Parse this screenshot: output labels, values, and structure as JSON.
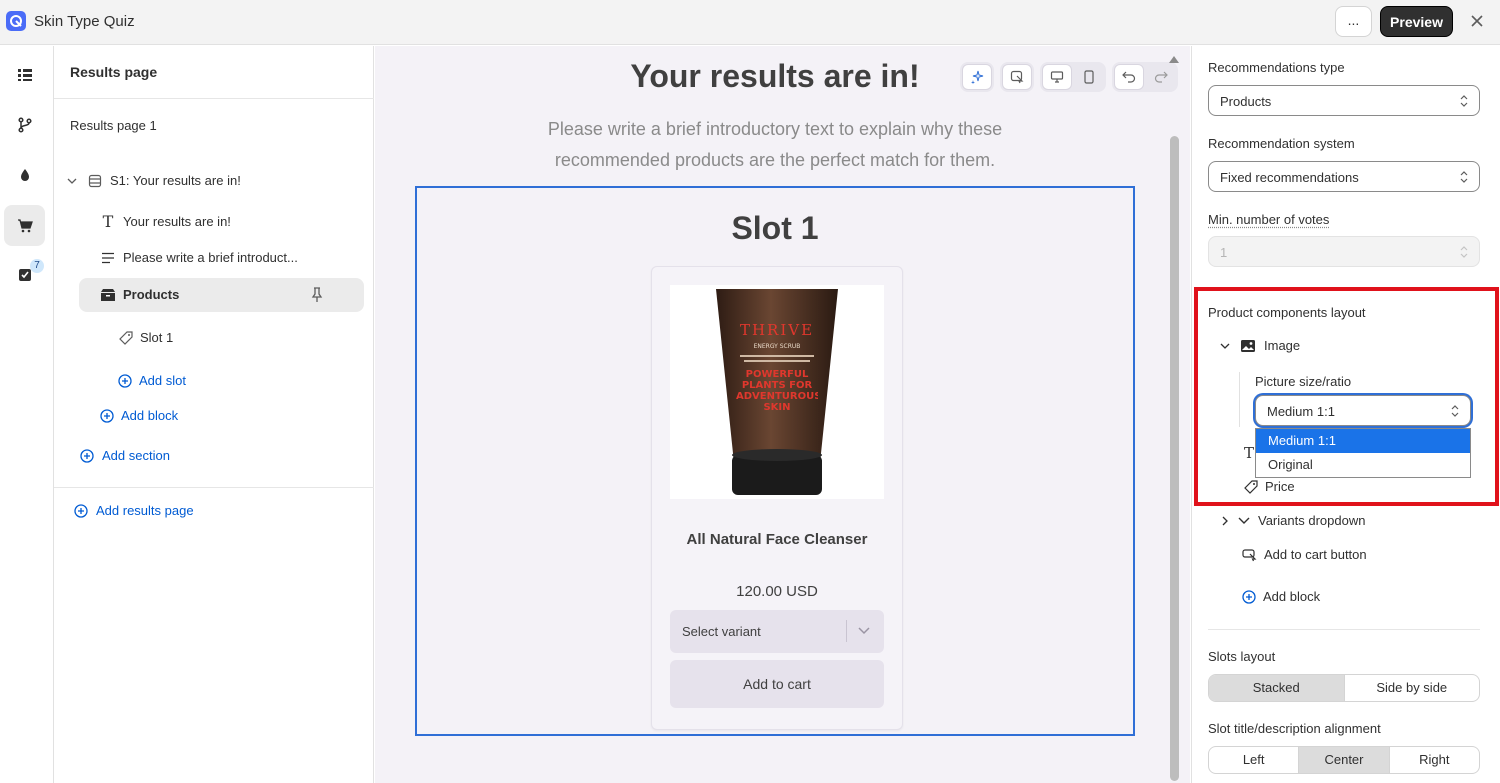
{
  "app": {
    "title": "Skin Type Quiz"
  },
  "topbar": {
    "more_label": "...",
    "preview_label": "Preview"
  },
  "rail": {
    "badge_count": "7"
  },
  "sidebar": {
    "header": "Results page",
    "results_page": "Results page 1",
    "section": "S1: Your results are in!",
    "blocks": {
      "heading": "Your results are in!",
      "text": "Please write a brief introduct...",
      "products": "Products",
      "slot": "Slot 1"
    },
    "add_slot": "Add slot",
    "add_block": "Add block",
    "add_section": "Add section",
    "add_results_page": "Add results page"
  },
  "canvas": {
    "title": "Your results are in!",
    "intro": "Please write a brief introductory text to explain why these recommended products are the perfect match for them.",
    "slot_title": "Slot 1",
    "product": {
      "image_text_1": "THRIVE",
      "image_text_2": "ENERGY SCRUB",
      "image_text_3": "POWERFUL PLANTS FOR ADVENTUROUS SKIN",
      "name": "All Natural Face Cleanser",
      "price": "120.00 USD",
      "variant_placeholder": "Select variant",
      "add_to_cart": "Add to cart"
    }
  },
  "panel": {
    "recommendations_type_label": "Recommendations type",
    "recommendations_type_value": "Products",
    "recommendation_system_label": "Recommendation system",
    "recommendation_system_value": "Fixed recommendations",
    "min_votes_label": "Min. number of votes",
    "min_votes_value": "1",
    "layout_label": "Product components layout",
    "components": {
      "image": "Image",
      "picture_size_label": "Picture size/ratio",
      "picture_size_value": "Medium 1:1",
      "options": [
        "Medium 1:1",
        "Original"
      ],
      "price": "Price",
      "variants": "Variants dropdown",
      "add_to_cart": "Add to cart button"
    },
    "add_block": "Add block",
    "slots_layout_label": "Slots layout",
    "slots_layout_options": [
      "Stacked",
      "Side by side"
    ],
    "alignment_label": "Slot title/description alignment",
    "alignment_options": [
      "Left",
      "Center",
      "Right"
    ]
  },
  "colors": {
    "link_blue": "#005bd3",
    "selection_border": "#2f6fd6",
    "highlight_red": "#e0121b",
    "dropdown_selected": "#1a73e8"
  }
}
